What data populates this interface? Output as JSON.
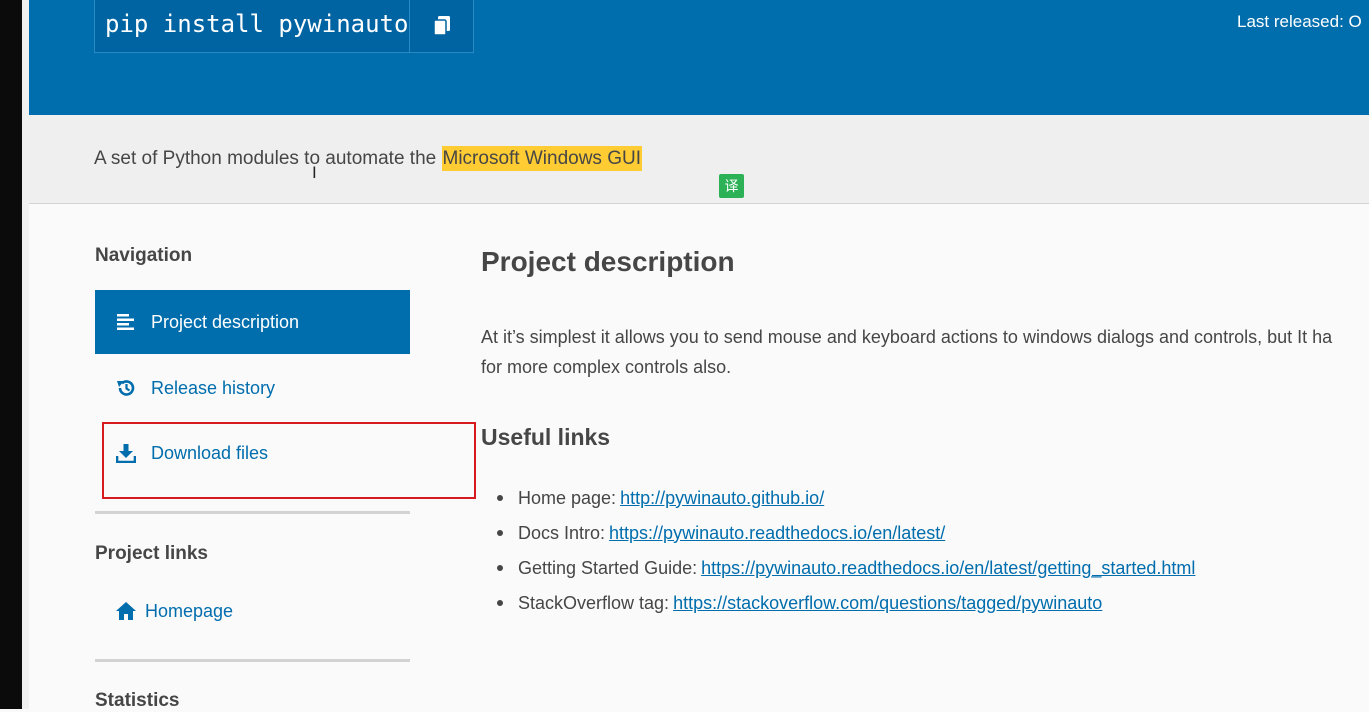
{
  "header": {
    "pip_command": "pip install pywinauto",
    "copy_icon": "copy-icon",
    "last_released": "Last released: O"
  },
  "banner": {
    "summary_plain": "A set of Python modules to automate the ",
    "summary_highlight": "Microsoft Windows GUI",
    "translate_label": "译"
  },
  "sidebar": {
    "navigation_heading": "Navigation",
    "nav_items": [
      {
        "label": "Project description",
        "icon": "list-icon",
        "active": true
      },
      {
        "label": "Release history",
        "icon": "history-icon",
        "active": false
      },
      {
        "label": "Download files",
        "icon": "download-icon",
        "active": false
      }
    ],
    "project_links_heading": "Project links",
    "homepage_label": "Homepage",
    "statistics_heading": "Statistics"
  },
  "main": {
    "title": "Project description",
    "description_line1": "At it’s simplest it allows you to send mouse and keyboard actions to windows dialogs and controls, but It ha",
    "description_line2": "for more complex controls also.",
    "useful_links_heading": "Useful links",
    "links": [
      {
        "label": "Home page:",
        "url": "http://pywinauto.github.io/"
      },
      {
        "label": "Docs Intro:",
        "url": "https://pywinauto.readthedocs.io/en/latest/"
      },
      {
        "label": "Getting Started Guide:",
        "url": "https://pywinauto.readthedocs.io/en/latest/getting_started.html"
      },
      {
        "label": "StackOverflow tag:",
        "url": "https://stackoverflow.com/questions/tagged/pywinauto"
      }
    ]
  },
  "colors": {
    "brand_blue": "#006dad",
    "highlight": "#ffcc33",
    "annotation_red": "#d71a1f",
    "translate_green": "#2db157"
  }
}
